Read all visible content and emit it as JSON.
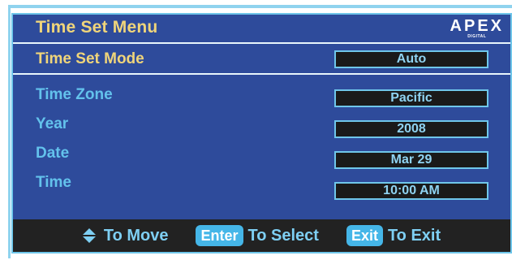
{
  "menu": {
    "title": "Time Set Menu",
    "logo_text": "APEX",
    "logo_sub": "DIGITAL"
  },
  "rows": [
    {
      "label": "Time Set Mode",
      "value": "Auto"
    },
    {
      "label": "Time Zone",
      "value": "Pacific"
    },
    {
      "label": "Year",
      "value": "2008"
    },
    {
      "label": "Date",
      "value": "Mar 29"
    },
    {
      "label": "Time",
      "value": "10:00 AM"
    }
  ],
  "footer": {
    "move_text": "To Move",
    "enter_key": "Enter",
    "select_text": "To Select",
    "exit_key": "Exit",
    "exit_text": "To Exit"
  },
  "colors": {
    "panel": "#2e4b9b",
    "highlight_text": "#f0d57a",
    "label_text": "#63c2ec",
    "field_bg": "#1a1a1a",
    "accent": "#45b6e8"
  }
}
